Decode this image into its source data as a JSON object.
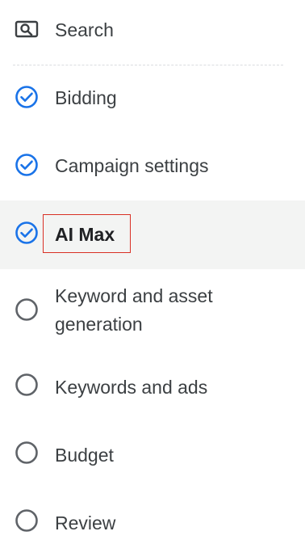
{
  "nav": {
    "search": {
      "label": "Search",
      "icon": "search-icon"
    },
    "steps": [
      {
        "label": "Bidding",
        "status": "completed",
        "icon": "check-circle-icon"
      },
      {
        "label": "Campaign settings",
        "status": "completed",
        "icon": "check-circle-icon"
      },
      {
        "label": "AI Max",
        "status": "completed",
        "active": true,
        "icon": "check-circle-icon"
      },
      {
        "label": "Keyword and asset generation",
        "status": "pending",
        "icon": "empty-circle-icon"
      },
      {
        "label": "Keywords and ads",
        "status": "pending",
        "icon": "empty-circle-icon"
      },
      {
        "label": "Budget",
        "status": "pending",
        "icon": "empty-circle-icon"
      },
      {
        "label": "Review",
        "status": "pending",
        "icon": "empty-circle-icon"
      }
    ]
  },
  "colors": {
    "check_blue": "#1a73e8",
    "pending_gray": "#5f6368",
    "active_background": "#f3f4f3",
    "highlight_red": "#d93025",
    "text": "#3c4043"
  }
}
